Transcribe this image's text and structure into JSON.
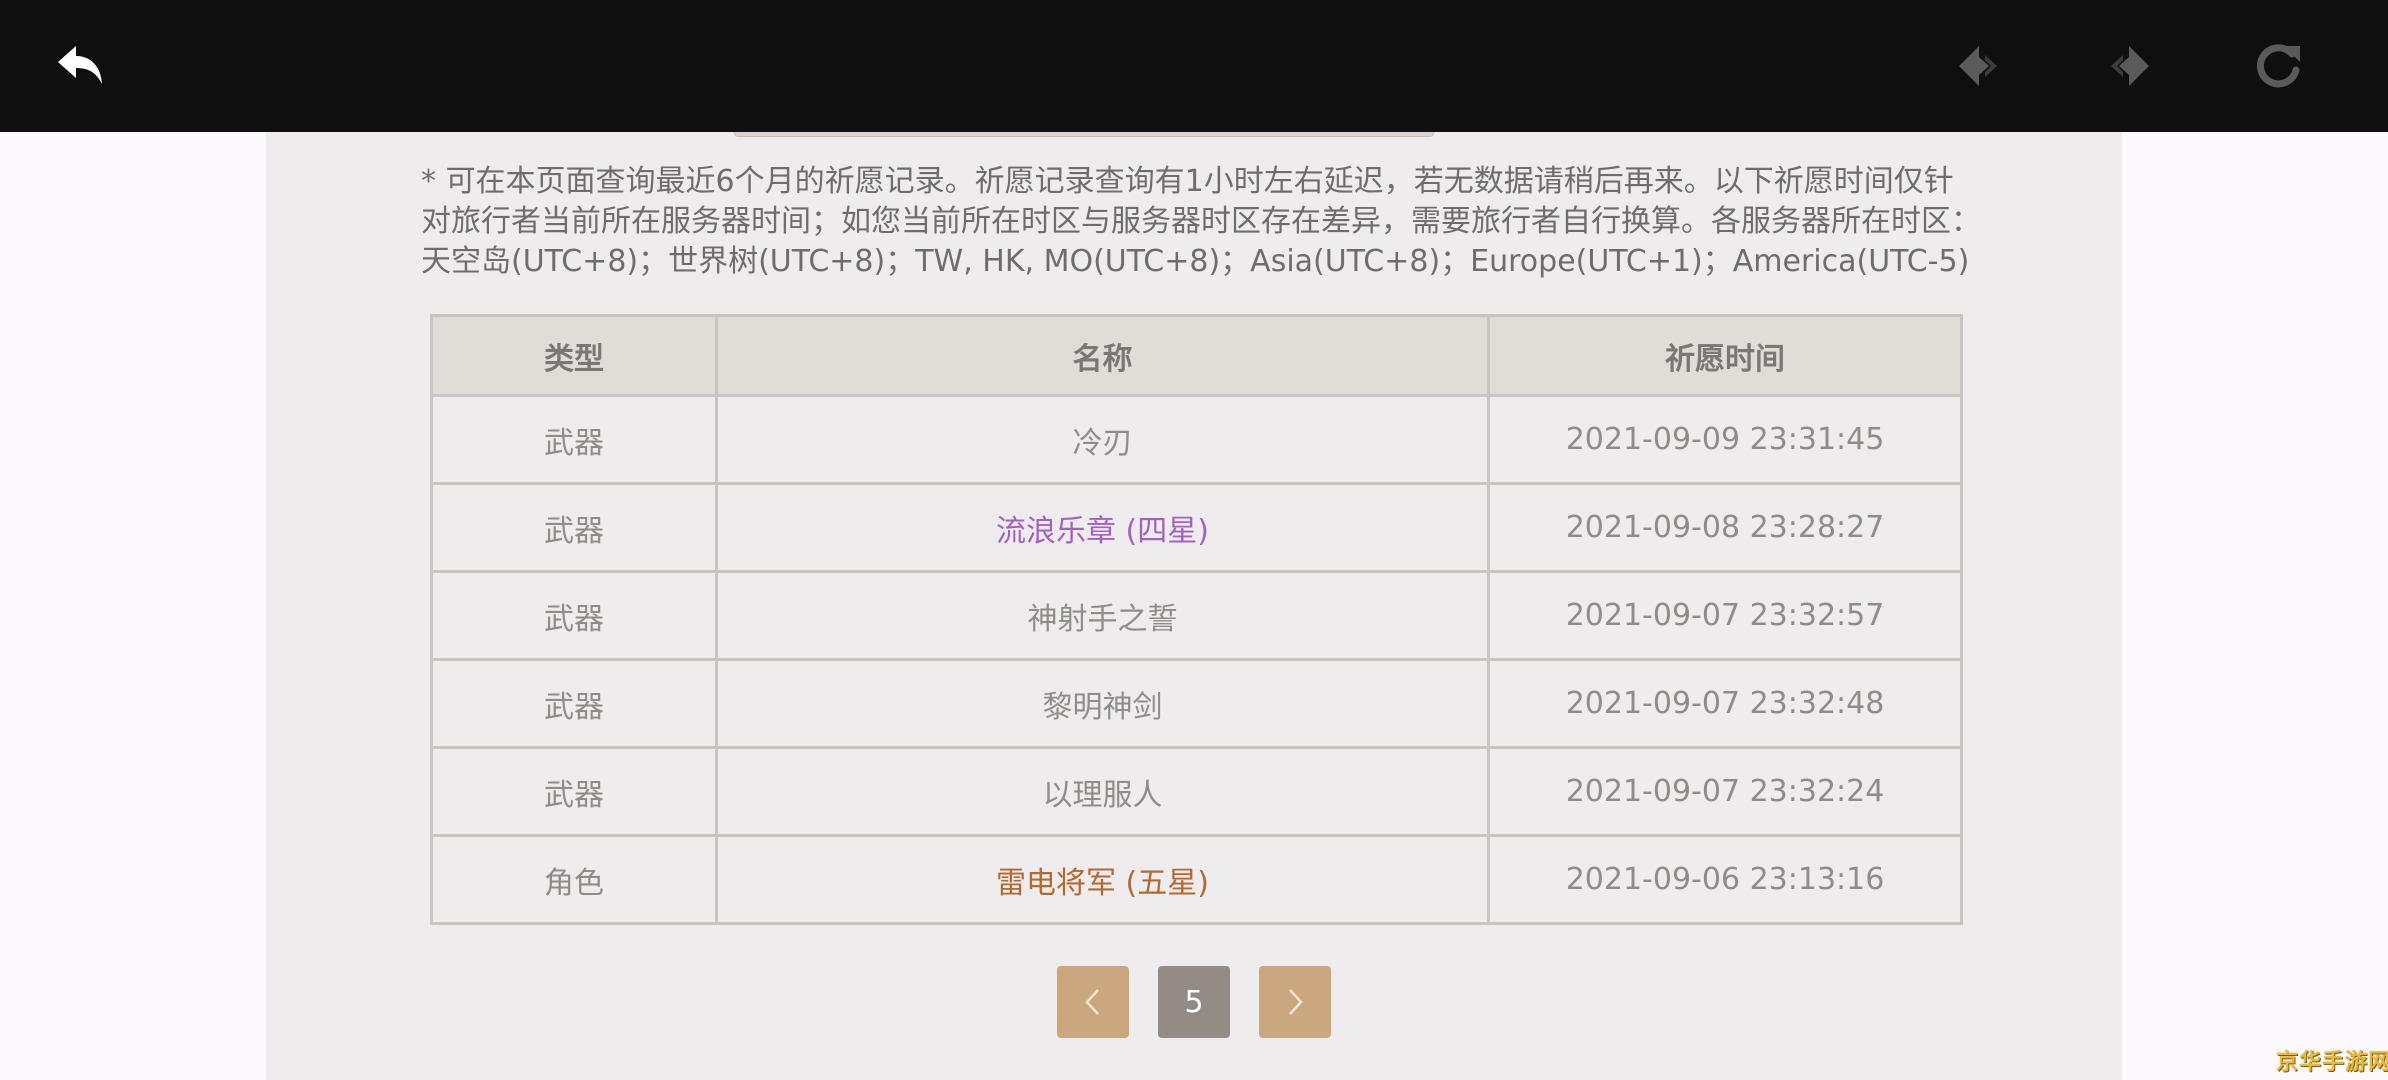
{
  "topbar": {
    "back_icon": "back-arrow-icon",
    "prev_icon": "nav-back-icon",
    "next_icon": "nav-forward-icon",
    "refresh_icon": "refresh-icon",
    "colors": {
      "background": "#0f0f0f",
      "icon_active": "#ffffff",
      "icon_disabled": "#5a5a5a"
    }
  },
  "notice": {
    "text": "* 可在本页面查询最近6个月的祈愿记录。祈愿记录查询有1小时左右延迟，若无数据请稍后再来。以下祈愿时间仅针对旅行者当前所在服务器时间；如您当前所在时区与服务器时区存在差异，需要旅行者自行换算。各服务器所在时区：天空岛(UTC+8)；世界树(UTC+8)；TW, HK, MO(UTC+8)；Asia(UTC+8)；Europe(UTC+1)；America(UTC-5)"
  },
  "table": {
    "headers": [
      "类型",
      "名称",
      "祈愿时间"
    ],
    "rows": [
      {
        "type": "武器",
        "name": "冷刃",
        "time": "2021-09-09 23:31:45"
      },
      {
        "type": "武器",
        "name": "流浪乐章 (四星)",
        "time": "2021-09-08 23:28:27"
      },
      {
        "type": "武器",
        "name": "神射手之誓",
        "time": "2021-09-07 23:32:57"
      },
      {
        "type": "武器",
        "name": "黎明神剑",
        "time": "2021-09-07 23:32:48"
      },
      {
        "type": "武器",
        "name": "以理服人",
        "time": "2021-09-07 23:32:24"
      },
      {
        "type": "角色",
        "name": "雷电将军 (五星)",
        "time": "2021-09-06 23:13:16"
      }
    ],
    "colors": {
      "four_star": "#a361c4",
      "five_star": "#b36a30",
      "header_bg": "#e0ddd8"
    }
  },
  "pagination": {
    "prev_icon": "chevron-left-icon",
    "current_page": "5",
    "next_icon": "chevron-right-icon",
    "colors": {
      "nav_button": "#cba77f",
      "current_page": "#938b85"
    }
  },
  "watermark": {
    "text": "京华手游网"
  }
}
